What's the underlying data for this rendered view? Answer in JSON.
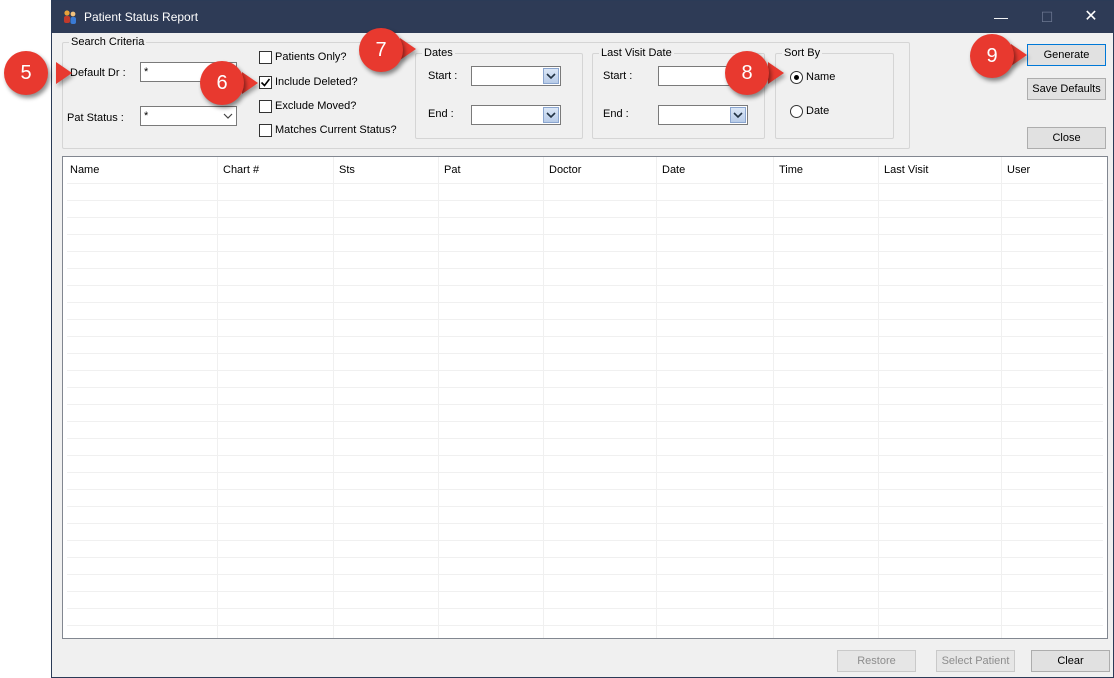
{
  "window": {
    "title": "Patient Status Report",
    "controls": {
      "minimize": "—",
      "maximize": "☐",
      "close": "✕"
    }
  },
  "search_criteria": {
    "legend": "Search Criteria",
    "default_dr_label": "Default Dr :",
    "default_dr_value": "*",
    "pat_status_label": "Pat Status :",
    "pat_status_value": "*"
  },
  "options": {
    "patients_only": {
      "label": "Patients Only?",
      "checked": false
    },
    "include_deleted": {
      "label": "Include Deleted?",
      "checked": true
    },
    "exclude_moved": {
      "label": "Exclude Moved?",
      "checked": false
    },
    "matches_current_status": {
      "label": "Matches Current Status?",
      "checked": false
    }
  },
  "dates": {
    "legend": "Dates",
    "start_label": "Start :",
    "end_label": "End :",
    "start_value": "",
    "end_value": ""
  },
  "last_visit": {
    "legend": "Last Visit Date",
    "start_label": "Start :",
    "end_label": "End :",
    "start_value": "",
    "end_value": ""
  },
  "sort_by": {
    "legend": "Sort By",
    "name_label": "Name",
    "date_label": "Date",
    "selected": "Name"
  },
  "buttons": {
    "generate": "Generate",
    "save_defaults": "Save Defaults",
    "close": "Close",
    "restore": "Restore",
    "select_patient": "Select Patient",
    "clear": "Clear"
  },
  "grid": {
    "columns": [
      "Name",
      "Chart #",
      "Sts",
      "Pat",
      "Doctor",
      "Date",
      "Time",
      "Last Visit",
      "User"
    ],
    "rows": []
  },
  "callouts": [
    "5",
    "6",
    "7",
    "8",
    "9"
  ],
  "colors": {
    "titlebar": "#2e3b56",
    "callout": "#e8392f",
    "window_bg": "#f0f0f0",
    "accent_border": "#0078d7"
  }
}
